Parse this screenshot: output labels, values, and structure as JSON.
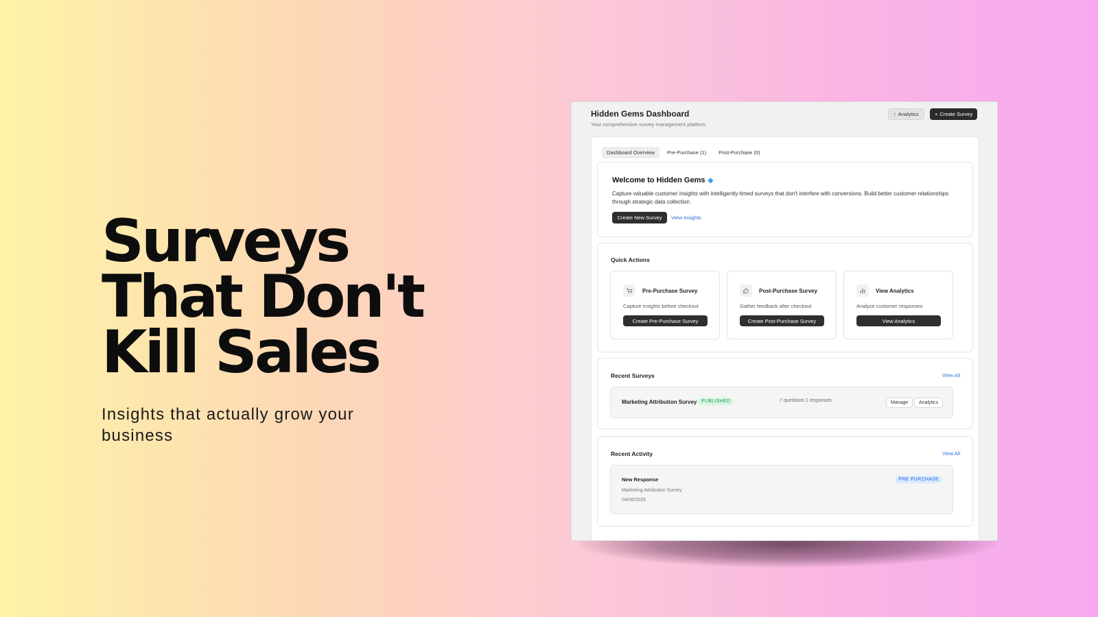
{
  "hero": {
    "title_lines": [
      "Surveys",
      "That Don't",
      "Kill Sales"
    ],
    "subtitle": "Insights that actually grow your business"
  },
  "dashboard": {
    "title": "Hidden Gems Dashboard",
    "subtitle": "Your comprehensive survey management platform",
    "header_buttons": {
      "analytics": "Analytics",
      "create_survey": "Create Survey"
    },
    "tabs": [
      {
        "label": "Dashboard Overview",
        "active": true
      },
      {
        "label": "Pre-Purchase (1)",
        "active": false
      },
      {
        "label": "Post-Purchase (0)",
        "active": false
      }
    ],
    "welcome": {
      "title": "Welcome to Hidden Gems",
      "icon": "gem-icon",
      "text": "Capture valuable customer insights with intelligently-timed surveys that don't interfere with conversions. Build better customer relationships through strategic data collection.",
      "primary_button": "Create New Survey",
      "link": "View Insights"
    },
    "quick_actions": {
      "title": "Quick Actions",
      "items": [
        {
          "icon": "cart-icon",
          "title": "Pre-Purchase Survey",
          "desc": "Capture insights before checkout",
          "button": "Create Pre-Purchase Survey"
        },
        {
          "icon": "thumbs-up-icon",
          "title": "Post-Purchase Survey",
          "desc": "Gather feedback after checkout",
          "button": "Create Post-Purchase Survey"
        },
        {
          "icon": "bar-chart-icon",
          "title": "View Analytics",
          "desc": "Analyze customer responses",
          "button": "View Analytics"
        }
      ]
    },
    "recent_surveys": {
      "title": "Recent Surveys",
      "view_all": "View All",
      "rows": [
        {
          "name": "Marketing Attribution Survey",
          "status": "PUBLISHED",
          "meta": "7 questions  1 responses",
          "actions": [
            "Manage",
            "Analytics"
          ]
        }
      ]
    },
    "recent_activity": {
      "title": "Recent Activity",
      "view_all": "View All",
      "items": [
        {
          "title": "New Response",
          "survey": "Marketing Attribution Survey",
          "date": "04/06/2025",
          "badge": "PRE PURCHASE"
        }
      ]
    }
  },
  "colors": {
    "accent_dark": "#2f2f2f",
    "link_blue": "#2d6fd6",
    "published_green": "#1e9c55",
    "badge_blue": "#2563eb"
  }
}
